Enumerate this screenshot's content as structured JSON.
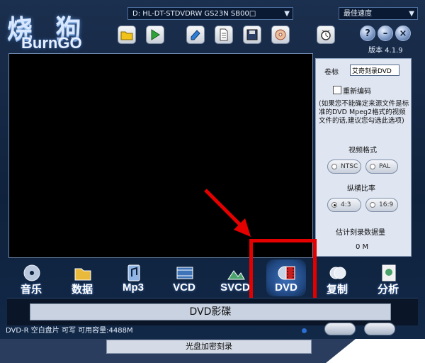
{
  "header": {
    "logo_cn": "烧 狗",
    "logo_en": "BurnGO",
    "drive": "D: HL-DT-STDVDRW  GS23N    SB00□",
    "speed": "最佳速度",
    "version": "版本 4.1.9"
  },
  "toolbar": {
    "icons": [
      "folder-open-icon",
      "play-icon",
      "erase-icon",
      "document-icon",
      "save-icon",
      "disc-burn-icon",
      "timer-icon"
    ],
    "help_label": "?",
    "minimize_label": "–",
    "close_label": "×"
  },
  "panel": {
    "title_label": "卷标",
    "title_value": "艾奇刻录DVD",
    "reencode_label": "重新编码",
    "hint": "(如果您不能确定来源文件是标准的DVD Mpeg2格式的视频文件的话,建议您勾选此选项)",
    "video_format_label": "视频格式",
    "ntsc": "NTSC",
    "pal": "PAL",
    "aspect_label": "纵横比率",
    "aspect_43": "4:3",
    "aspect_169": "16:9",
    "estimate_label": "估计刻录数据量",
    "estimate_value": "0 M"
  },
  "categories": [
    {
      "label": "音乐",
      "icon": "music-disc-icon"
    },
    {
      "label": "数据",
      "icon": "data-folder-icon"
    },
    {
      "label": "Mp3",
      "icon": "mp3-icon"
    },
    {
      "label": "VCD",
      "icon": "vcd-icon"
    },
    {
      "label": "SVCD",
      "icon": "svcd-icon"
    },
    {
      "label": "DVD",
      "icon": "dvd-film-icon"
    },
    {
      "label": "复制",
      "icon": "copy-disc-icon"
    },
    {
      "label": "分析",
      "icon": "analyze-icon"
    }
  ],
  "banner": {
    "text": "DVD影碟"
  },
  "status": {
    "text": "DVD-R 空白盘片 可写 可用容量:4488M"
  },
  "bottom": {
    "button": "光盘加密刻录"
  },
  "colors": {
    "accent_red": "#e50000",
    "background": "#0f223d",
    "panel": "#dfe6f2"
  }
}
